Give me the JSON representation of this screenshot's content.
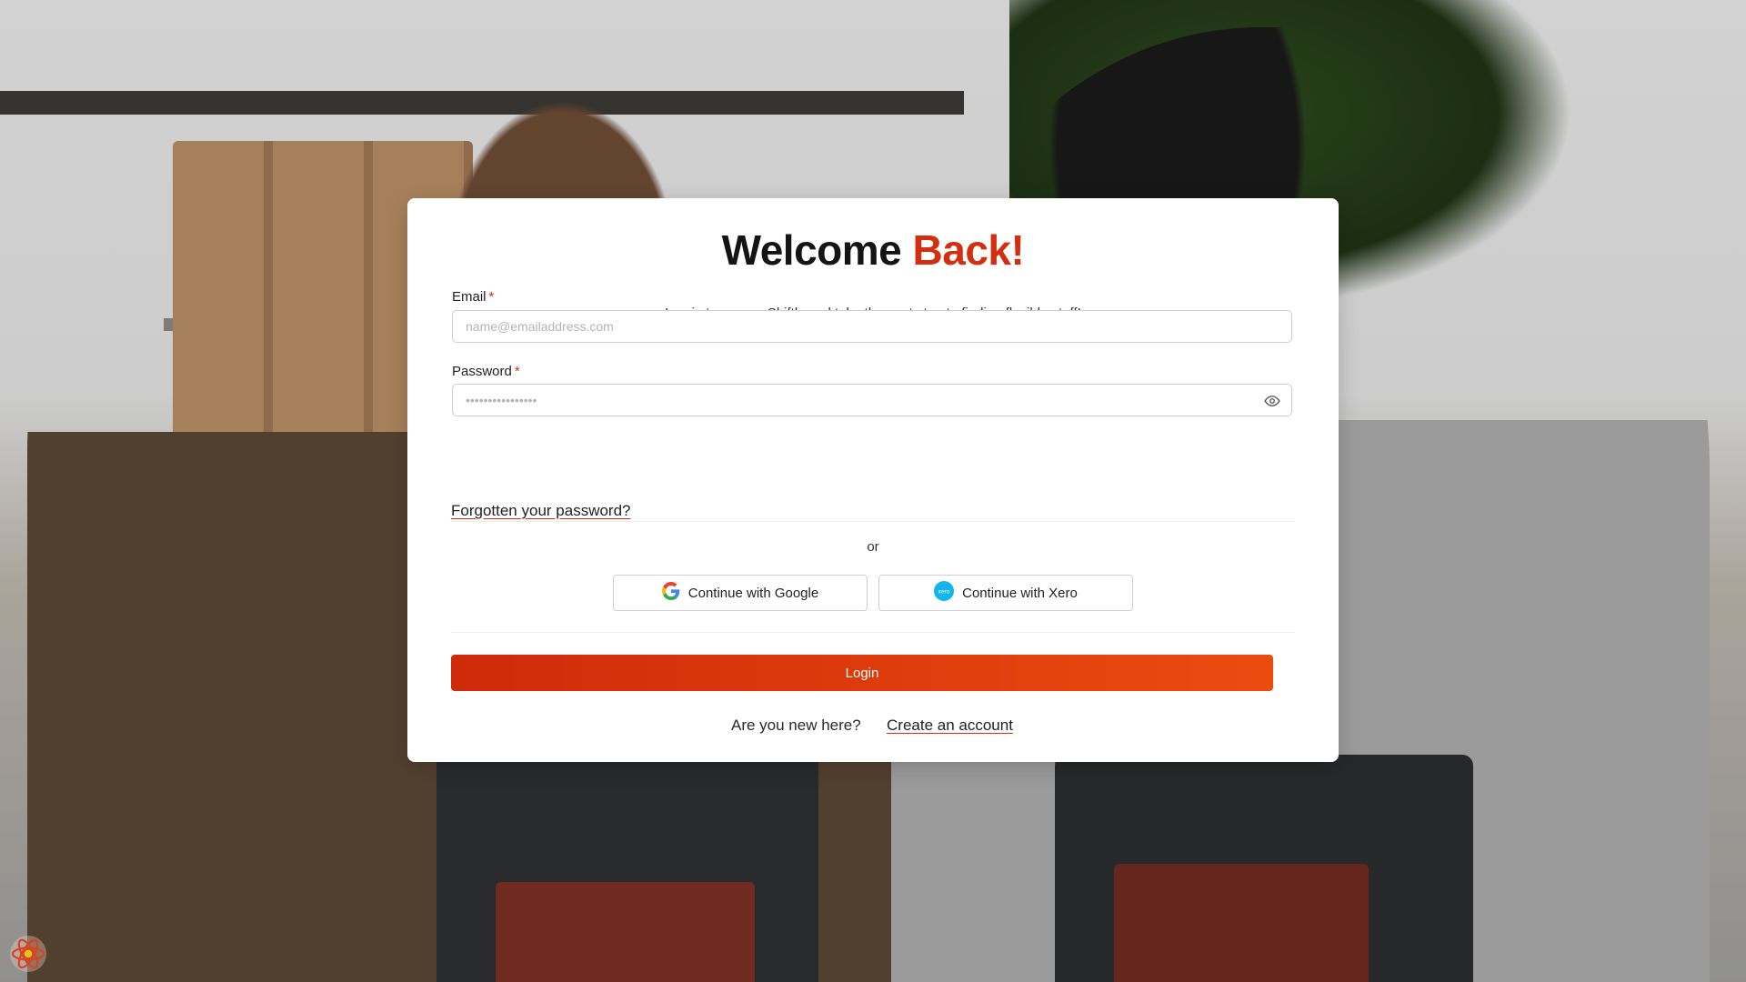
{
  "page": {
    "title_main": "Welcome",
    "title_accent": "Back!",
    "subtitle": "Log in to access Shiftly and take the next step to finding flexible staff!"
  },
  "form": {
    "email": {
      "label": "Email",
      "required_mark": "*",
      "placeholder": "name@emailaddress.com",
      "value": ""
    },
    "password": {
      "label": "Password",
      "required_mark": "*",
      "placeholder": "••••••••••••••••",
      "value": ""
    },
    "forgot_link": "Forgotten your password?",
    "separator": "or",
    "google_button": "Continue with Google",
    "xero_button": "Continue with Xero",
    "login_button": "Login",
    "signup_prompt": "Are you new here?",
    "signup_link": "Create an account"
  },
  "icons": {
    "password_toggle": "eye-icon",
    "google": "google-logo-icon",
    "xero": "xero-logo-icon",
    "devtools": "react-devtools-icon"
  },
  "colors": {
    "accent": "#d32f0f",
    "login_gradient_start": "#cf2a0a",
    "login_gradient_end": "#ea4c10",
    "xero_blue": "#13b5ea"
  }
}
